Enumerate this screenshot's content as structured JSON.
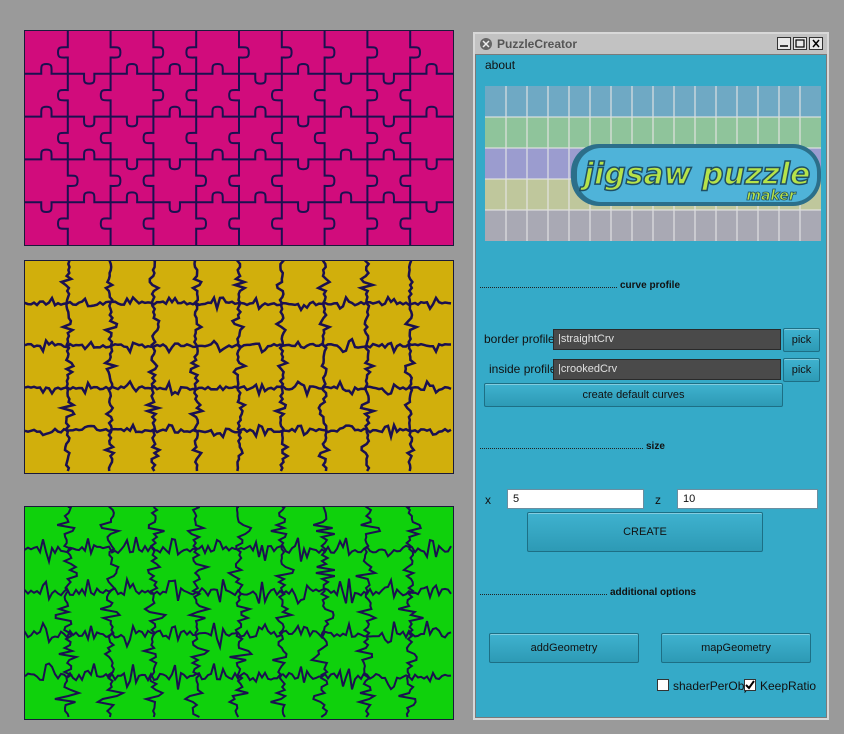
{
  "window": {
    "title": "PuzzleCreator",
    "menu": {
      "about": "about"
    }
  },
  "logo": {
    "line1": "jigsaw puzzle",
    "line2": "maker"
  },
  "sections": {
    "curve_profile": "curve profile",
    "size": "size",
    "additional_options": "additional options"
  },
  "curve_profile": {
    "border_label": "border profile",
    "border_value": "|straightCrv",
    "inside_label": "inside profile",
    "inside_value": "|crookedCrv",
    "pick": "pick",
    "create_default": "create default curves"
  },
  "size": {
    "x_label": "x",
    "x_value": "5",
    "z_label": "z",
    "z_value": "10",
    "create": "CREATE"
  },
  "options": {
    "add_geometry": "addGeometry",
    "map_geometry": "mapGeometry",
    "shader_per_obj": "shaderPerObj",
    "shader_per_obj_checked": false,
    "keep_ratio": "KeepRatio",
    "keep_ratio_checked": true
  },
  "viewport": {
    "panel_colors": [
      "#d10c7c",
      "#d1af0c",
      "#0fd10c"
    ],
    "cut_color": "#1b1050"
  }
}
